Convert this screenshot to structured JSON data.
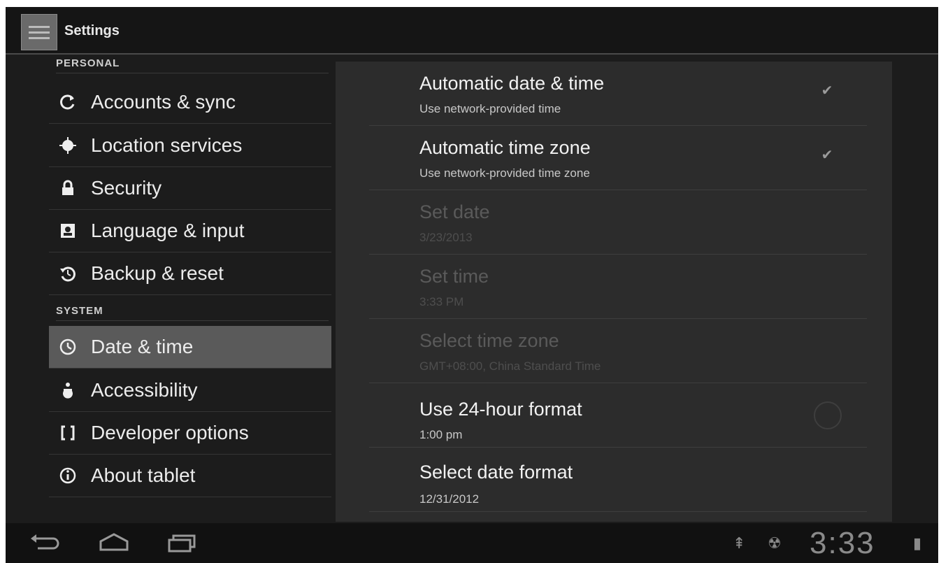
{
  "action_bar": {
    "title": "Settings"
  },
  "sections": {
    "personal": "PERSONAL",
    "system": "SYSTEM"
  },
  "nav_items": [
    {
      "label": "Accounts & sync",
      "icon": "sync-icon"
    },
    {
      "label": "Location services",
      "icon": "location-icon"
    },
    {
      "label": "Security",
      "icon": "lock-icon"
    },
    {
      "label": "Language & input",
      "icon": "language-icon"
    },
    {
      "label": "Backup & reset",
      "icon": "backup-icon"
    },
    {
      "label": "Date & time",
      "icon": "clock-icon",
      "selected": true
    },
    {
      "label": "Accessibility",
      "icon": "accessibility-icon"
    },
    {
      "label": "Developer options",
      "icon": "developer-icon"
    },
    {
      "label": "About tablet",
      "icon": "info-icon"
    }
  ],
  "prefs": {
    "auto_datetime": {
      "title": "Automatic date & time",
      "summary": "Use network-provided time",
      "checked": true
    },
    "auto_timezone": {
      "title": "Automatic time zone",
      "summary": "Use network-provided time zone",
      "checked": true
    },
    "set_date": {
      "title": "Set date",
      "summary": "3/23/2013",
      "enabled": false
    },
    "set_time": {
      "title": "Set time",
      "summary": "3:33 PM",
      "enabled": false
    },
    "select_timezone": {
      "title": "Select time zone",
      "summary": "GMT+08:00, China Standard Time",
      "enabled": false
    },
    "use_24h": {
      "title": "Use 24-hour format",
      "summary": "1:00 pm",
      "checked": false
    },
    "date_format": {
      "title": "Select date format",
      "summary": "12/31/2012"
    }
  },
  "status_bar": {
    "time": "3:33"
  },
  "colors": {
    "background": "#1c1c1c",
    "panel": "#2c2c2c",
    "selected": "#5a5a5a"
  }
}
